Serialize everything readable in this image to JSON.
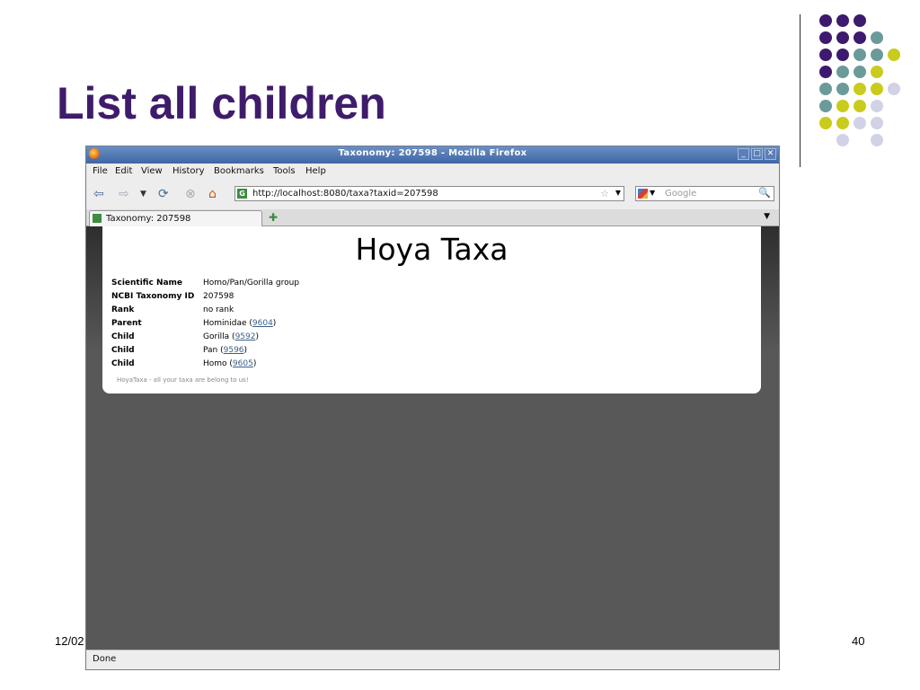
{
  "slide": {
    "title": "List all children",
    "date": "12/02",
    "page_number": "40"
  },
  "browser": {
    "window_title": "Taxonomy: 207598 - Mozilla Firefox",
    "menu": [
      "File",
      "Edit",
      "View",
      "History",
      "Bookmarks",
      "Tools",
      "Help"
    ],
    "url": "http://localhost:8080/taxa?taxid=207598",
    "search_placeholder": "Google",
    "tab_title": "Taxonomy: 207598",
    "status": "Done"
  },
  "page": {
    "heading": "Hoya Taxa",
    "fields": [
      {
        "label": "Scientific Name",
        "value": "Homo/Pan/Gorilla group",
        "link": ""
      },
      {
        "label": "NCBI Taxonomy ID",
        "value": "207598",
        "link": ""
      },
      {
        "label": "Rank",
        "value": "no rank",
        "link": ""
      },
      {
        "label": "Parent",
        "value": "Hominidae (",
        "link": "9604",
        "suffix": ")"
      },
      {
        "label": "Child",
        "value": "Gorilla (",
        "link": "9592",
        "suffix": ")"
      },
      {
        "label": "Child",
        "value": "Pan (",
        "link": "9596",
        "suffix": ")"
      },
      {
        "label": "Child",
        "value": "Homo (",
        "link": "9605",
        "suffix": ")"
      }
    ],
    "footer": "HoyaTaxa - all your taxa are belong to us!"
  },
  "colors": {
    "title_purple": "#3f1c6b",
    "dot_purple": "#3d1a6e",
    "dot_teal": "#6b9a9a",
    "dot_yellow": "#c9cc1c",
    "dot_lavender": "#d2d2e6",
    "link": "#3a5f88"
  }
}
